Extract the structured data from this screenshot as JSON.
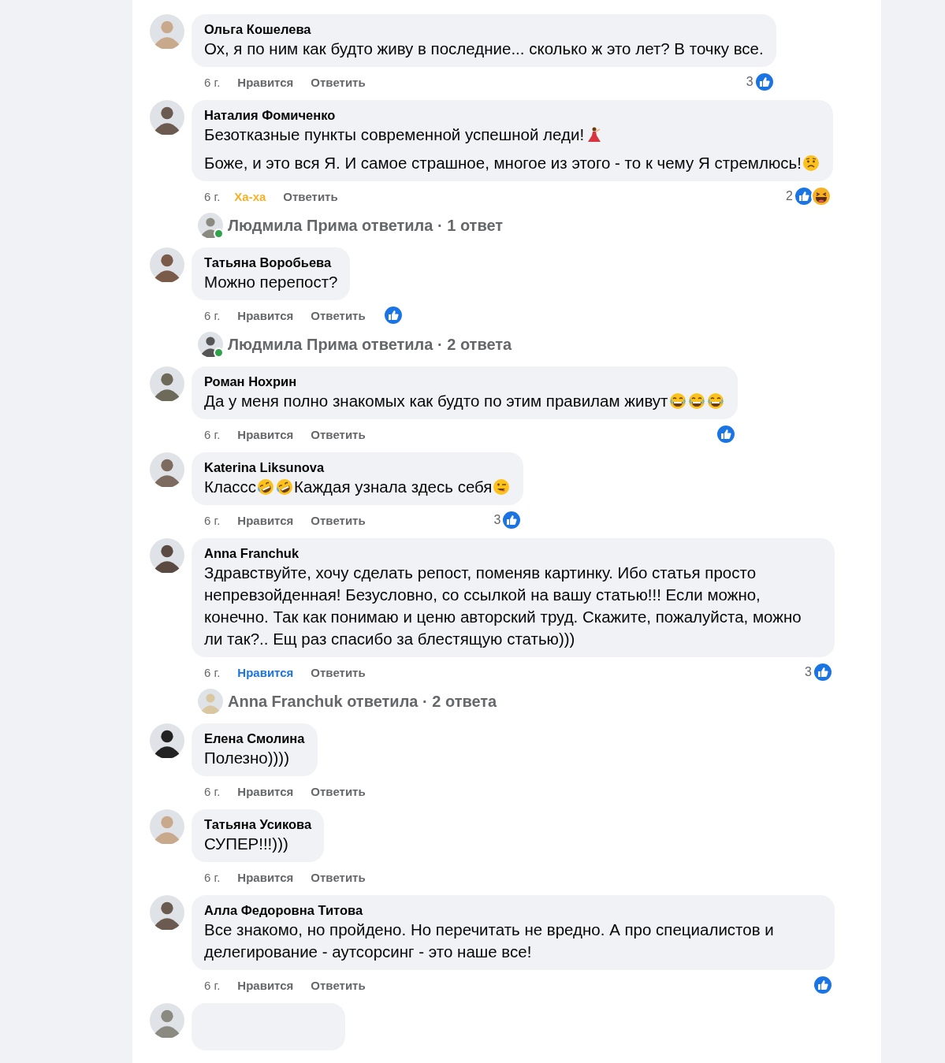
{
  "items": [
    {
      "kind": "comment",
      "name": "Ольга Кошелева",
      "paragraphs": [
        [
          {
            "kind": "text",
            "text": "Ох, я по ним как будто живу в последние... сколько ж это лет? В точку все."
          }
        ]
      ],
      "time": "6 г.",
      "like": {
        "label": "Нравится",
        "kind": "plain"
      },
      "reply": "Ответить",
      "reactions": {
        "count": "3",
        "icons": [
          {
            "kind": "like"
          }
        ]
      }
    },
    {
      "kind": "comment",
      "name": "Наталия Фомиченко",
      "paragraphs": [
        [
          {
            "kind": "text",
            "text": "Безотказные пункты современной успешной леди!"
          },
          {
            "kind": "dancer"
          }
        ],
        [
          {
            "kind": "text",
            "text": "Боже, и это вся Я. И самое страшное, многое из этого - то к чему Я стремлюсь!"
          },
          {
            "kind": "worried"
          }
        ]
      ],
      "time": "6 г.",
      "like": {
        "label": "Ха-ха",
        "kind": "haha"
      },
      "reply": "Ответить",
      "reactions": {
        "count": "2",
        "icons": [
          {
            "kind": "like"
          },
          {
            "kind": "haha"
          }
        ]
      }
    },
    {
      "kind": "replies",
      "text": "Людмила Прима ответила · 1 ответ",
      "online": true
    },
    {
      "kind": "comment",
      "name": "Татьяна Воробьева",
      "paragraphs": [
        [
          {
            "kind": "text",
            "text": "Можно перепост?"
          }
        ]
      ],
      "time": "6 г.",
      "like": {
        "label": "Нравится",
        "kind": "plain"
      },
      "reply": "Ответить",
      "reactions": {
        "icons": [
          {
            "kind": "like"
          }
        ]
      }
    },
    {
      "kind": "replies",
      "text": "Людмила Прима ответила · 2 ответа",
      "online": true
    },
    {
      "kind": "comment",
      "name": "Роман Нохрин",
      "paragraphs": [
        [
          {
            "kind": "text",
            "text": "Да у меня полно знакомых как будто по этим правилам живут"
          },
          {
            "kind": "grin"
          },
          {
            "kind": "grin"
          },
          {
            "kind": "grin"
          }
        ]
      ],
      "time": "6 г.",
      "like": {
        "label": "Нравится",
        "kind": "plain"
      },
      "reply": "Ответить",
      "reactions": {
        "icons": [
          {
            "kind": "like"
          }
        ]
      }
    },
    {
      "kind": "comment",
      "name": "Katerina Liksunova",
      "paragraphs": [
        [
          {
            "kind": "text",
            "text": "Классс"
          },
          {
            "kind": "rofl"
          },
          {
            "kind": "rofl"
          },
          {
            "kind": "text",
            "text": "Каждая узнала здесь себя"
          },
          {
            "kind": "wink"
          }
        ]
      ],
      "time": "6 г.",
      "like": {
        "label": "Нравится",
        "kind": "plain"
      },
      "reply": "Ответить",
      "reactions": {
        "count": "3",
        "icons": [
          {
            "kind": "like"
          }
        ]
      }
    },
    {
      "kind": "comment",
      "name": "Anna Franchuk",
      "paragraphs": [
        [
          {
            "kind": "text",
            "text": "Здравствуйте, хочу сделать репост, поменяв картинку. Ибо статья просто непревзойденная! Безусловно, со ссылкой на вашу статью!!! Если можно, конечно. Так как понимаю и ценю авторский труд. Скажите, пожалуйста, можно ли так?.. Ещ раз спасибо за блестящую статью)))"
          }
        ]
      ],
      "time": "6 г.",
      "like": {
        "label": "Нравится",
        "kind": "like"
      },
      "reply": "Ответить",
      "reactions": {
        "count": "3",
        "icons": [
          {
            "kind": "like"
          }
        ]
      }
    },
    {
      "kind": "replies",
      "text": "Anna Franchuk ответила · 2 ответа",
      "online": false
    },
    {
      "kind": "comment",
      "name": "Елена Смолина",
      "paragraphs": [
        [
          {
            "kind": "text",
            "text": "Полезно))))"
          }
        ]
      ],
      "time": "6 г.",
      "like": {
        "label": "Нравится",
        "kind": "plain"
      },
      "reply": "Ответить"
    },
    {
      "kind": "comment",
      "name": "Татьяна Усикова",
      "paragraphs": [
        [
          {
            "kind": "text",
            "text": "СУПЕР!!!)))"
          }
        ]
      ],
      "time": "6 г.",
      "like": {
        "label": "Нравится",
        "kind": "plain"
      },
      "reply": "Ответить"
    },
    {
      "kind": "comment",
      "name": "Алла Федоровна Титова",
      "paragraphs": [
        [
          {
            "kind": "text",
            "text": "Все знакомо, но пройдено. Но перечитать не вредно. А про специалистов и делегирование - аутсорсинг - это наше все!"
          }
        ]
      ],
      "time": "6 г.",
      "like": {
        "label": "Нравится",
        "kind": "plain"
      },
      "reply": "Ответить",
      "reactions": {
        "icons": [
          {
            "kind": "like"
          }
        ]
      }
    },
    {
      "kind": "cut"
    }
  ]
}
